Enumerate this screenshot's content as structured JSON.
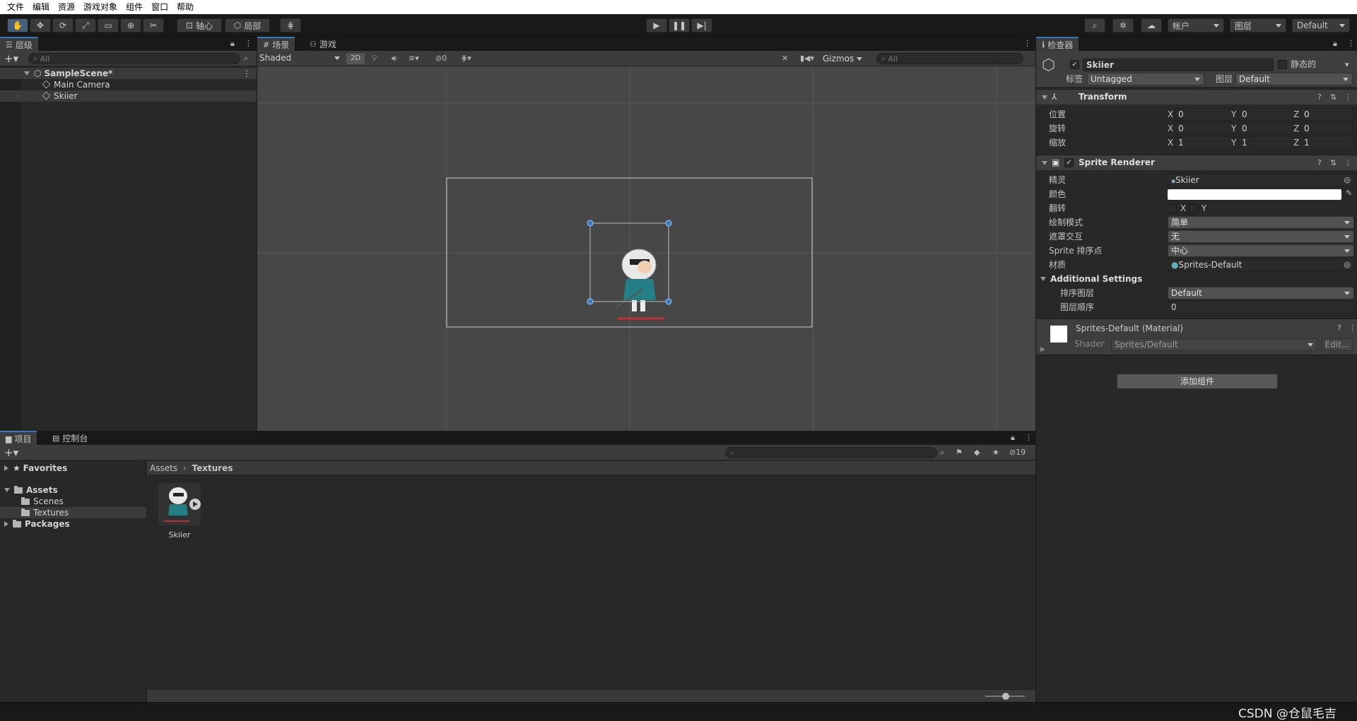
{
  "menu": [
    "文件",
    "编辑",
    "资源",
    "游戏对象",
    "组件",
    "窗口",
    "帮助"
  ],
  "toolbar": {
    "pivot_label": "轴心",
    "local_label": "局部",
    "account_label": "帐户",
    "layers_label": "图层",
    "layout_label": "Default"
  },
  "hierarchy": {
    "tab_label": "层级",
    "search_placeholder": "All",
    "scene_name": "SampleScene*",
    "items": [
      "Main Camera",
      "Skiier"
    ]
  },
  "scene_view": {
    "tab_scene": "场景",
    "tab_game": "游戏",
    "shading_mode": "Shaded",
    "mode_2d": "2D",
    "hidden_count": "0",
    "gizmos_label": "Gizmos",
    "search_placeholder": "All"
  },
  "project": {
    "tab_project": "项目",
    "tab_console": "控制台",
    "favorites": "Favorites",
    "assets": "Assets",
    "scenes": "Scenes",
    "textures": "Textures",
    "packages": "Packages",
    "breadcrumb": [
      "Assets",
      "Textures"
    ],
    "hidden_packages_count": "19",
    "asset_items": [
      "Skiier"
    ]
  },
  "inspector": {
    "tab_label": "检查器",
    "object_name": "Skiier",
    "static_label": "静态的",
    "tag_label": "标签",
    "tag_value": "Untagged",
    "layer_label": "图层",
    "layer_value": "Default",
    "transform": {
      "title": "Transform",
      "position_label": "位置",
      "rotation_label": "旋转",
      "scale_label": "缩放",
      "position": {
        "x": "0",
        "y": "0",
        "z": "0"
      },
      "rotation": {
        "x": "0",
        "y": "0",
        "z": "0"
      },
      "scale": {
        "x": "1",
        "y": "1",
        "z": "1"
      }
    },
    "sprite_renderer": {
      "title": "Sprite Renderer",
      "sprite_label": "精灵",
      "sprite_value": "Skiier",
      "color_label": "颜色",
      "flip_label": "翻转",
      "draw_mode_label": "绘制模式",
      "draw_mode_value": "简单",
      "mask_label": "遮罩交互",
      "mask_value": "无",
      "sort_point_label": "Sprite 排序点",
      "sort_point_value": "中心",
      "material_label": "材质",
      "material_value": "Sprites-Default",
      "additional_settings": "Additional Settings",
      "sorting_layer_label": "排序图层",
      "sorting_layer_value": "Default",
      "order_label": "图层顺序",
      "order_value": "0"
    },
    "material": {
      "title": "Sprites-Default (Material)",
      "shader_label": "Shader",
      "shader_value": "Sprites/Default",
      "edit_label": "Edit..."
    },
    "add_component": "添加组件"
  },
  "watermark": "CSDN @仓鼠毛吉",
  "colors": {
    "accent": "#3a79bb",
    "panel": "#282828",
    "scene_bg": "#474747",
    "selection": "#2c5d87"
  }
}
